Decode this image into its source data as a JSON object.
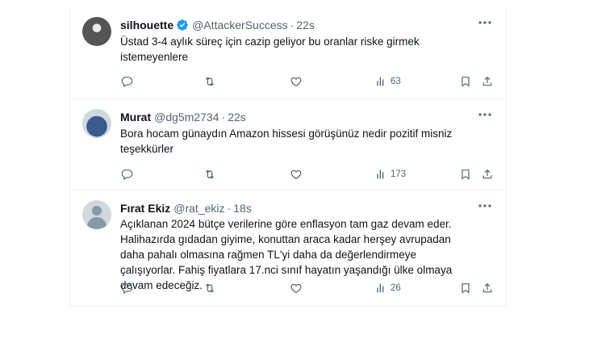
{
  "tweets": [
    {
      "name": "silhouette",
      "handle": "@AttackerSuccess",
      "separator": "·",
      "time": "22s",
      "verified": true,
      "text": "Üstad 3-4 aylık süreç için cazip geliyor bu oranlar riske girmek istemeyenlere",
      "views": "63"
    },
    {
      "name": "Murat",
      "handle": "@dg5m2734",
      "separator": "·",
      "time": "22s",
      "verified": false,
      "text": "Bora hocam günaydın Amazon hissesi görüşünüz nedir pozitif misniz teşekkürler",
      "views": "173"
    },
    {
      "name": "Fırat Ekiz",
      "handle": "@rat_ekiz",
      "separator": "·",
      "time": "18s",
      "verified": false,
      "text": "Açıklanan 2024 bütçe verilerine göre enflasyon tam gaz devam eder. Halihazırda gıdadan giyime, konuttan araca kadar herşey avrupadan daha pahalı olmasına rağmen TL'yi daha da değerlendirmeye çalışıyorlar. Fahiş fiyatlara 17.nci sınıf hayatın yaşandığı ülke olmaya devam edeceğiz.",
      "views": "26"
    }
  ],
  "icons": {
    "more": "more-icon",
    "reply": "reply-icon",
    "retweet": "retweet-icon",
    "like": "like-icon",
    "views": "views-icon",
    "bookmark": "bookmark-icon",
    "share": "share-icon",
    "verified": "verified-badge-icon"
  },
  "colors": {
    "text": "#0f1419",
    "secondary": "#536471",
    "verified": "#1d9bf0",
    "border": "#eff3f4"
  }
}
